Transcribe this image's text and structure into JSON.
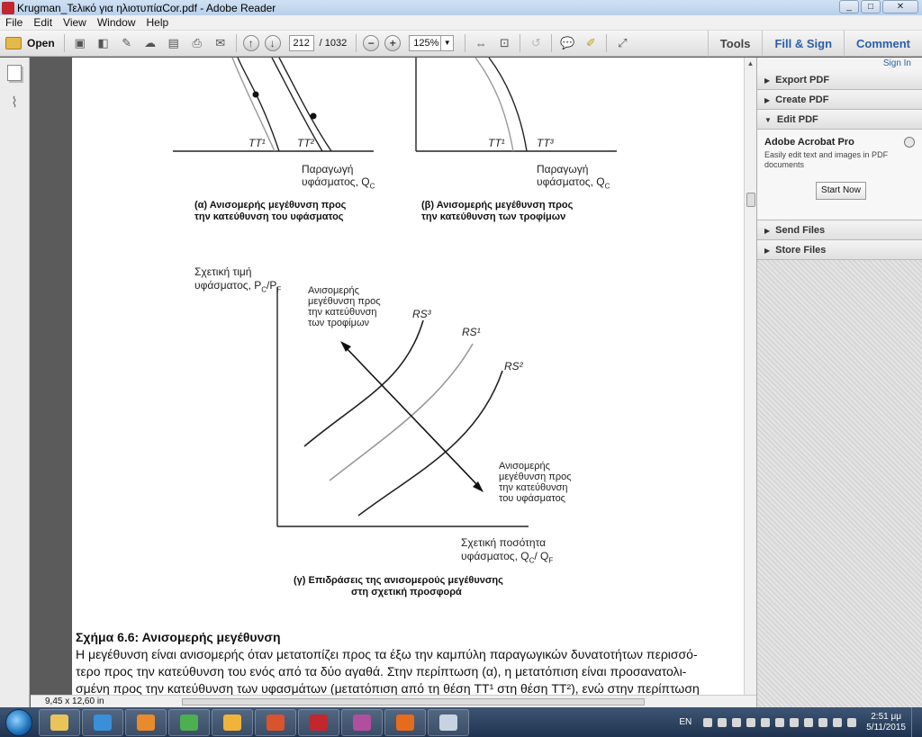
{
  "window": {
    "title": "Krugman_Τελικό για ηλιοτυπίαCor.pdf - Adobe Reader",
    "controls": [
      "_",
      "□",
      "✕"
    ]
  },
  "menu": [
    "File",
    "Edit",
    "View",
    "Window",
    "Help"
  ],
  "toolbar": {
    "open_label": "Open",
    "page_current": "212",
    "page_total": "/ 1032",
    "zoom": "125%",
    "tools_label": "Tools",
    "fill_sign_label": "Fill & Sign",
    "comment_label": "Comment"
  },
  "document": {
    "fig_top_left": {
      "curve1": "TT¹",
      "curve2": "TT²",
      "axis_label_line1": "Παραγωγή",
      "axis_label_line2": "υφάσματος, Q",
      "axis_sub": "C",
      "caption_line1": "(α) Ανισομερής μεγέθυνση προς",
      "caption_line2": "την κατεύθυνση του υφάσματος"
    },
    "fig_top_right": {
      "curve1": "TT¹",
      "curve2": "TT³",
      "axis_label_line1": "Παραγωγή",
      "axis_label_line2": "υφάσματος, Q",
      "axis_sub": "C",
      "caption_line1": "(β) Ανισομερής μεγέθυνση προς",
      "caption_line2": "την κατεύθυνση των τροφίμων"
    },
    "fig_bottom": {
      "y_label_line1": "Σχετική τιμή",
      "y_label_line2": "υφάσματος, P",
      "y_sub1": "C",
      "y_mid": "/P",
      "y_sub2": "F",
      "curve_rs3": "RS³",
      "curve_rs1": "RS¹",
      "curve_rs2": "RS²",
      "annot_food_1": "Ανισομερής",
      "annot_food_2": "μεγέθυνση προς",
      "annot_food_3": "την κατεύθυνση",
      "annot_food_4": "των τροφίμων",
      "annot_cloth_1": "Ανισομερής",
      "annot_cloth_2": "μεγέθυνση προς",
      "annot_cloth_3": "την κατεύθυνση",
      "annot_cloth_4": "του υφάσματος",
      "x_label_line1": "Σχετική ποσότητα",
      "x_label_line2": "υφάσματος, Q",
      "x_sub1": "C",
      "x_mid": "/ Q",
      "x_sub2": "F",
      "caption_line1": "(γ) Επιδράσεις της ανισομερούς μεγέθυνσης",
      "caption_line2": "στη σχετική προσφορά"
    },
    "section_title": "Σχήμα 6.6: Ανισομερής μεγέθυνση",
    "paragraph_lines": [
      "Η μεγέθυνση είναι ανισομερής όταν μετατοπίζει προς τα έξω την καμπύλη παραγωγικών δυνατοτήτων περισσό-",
      "τερο προς την κατεύθυνση του ενός από τα δύο αγαθά. Στην περίπτωση (α), η μετατόπιση είναι προσανατολι-",
      "σμένη προς την κατεύθυνση των υφασμάτων (μετατόπιση από τη θέση TT¹ στη θέση TT²), ενώ στην περίπτωση"
    ]
  },
  "statusbar": {
    "page_size": "9,45 x 12,60 in"
  },
  "rightpane": {
    "signin": "Sign In",
    "export_pdf": "Export PDF",
    "create_pdf": "Create PDF",
    "edit_pdf": "Edit PDF",
    "product": "Adobe Acrobat Pro",
    "product_desc": "Easily edit text and images in PDF documents",
    "start_now": "Start Now",
    "send_files": "Send Files",
    "store_files": "Store Files"
  },
  "taskbar": {
    "lang": "EN",
    "time": "2:51 μμ",
    "date": "5/11/2015",
    "apps": [
      {
        "name": "explorer",
        "color": "#e9c45a"
      },
      {
        "name": "internet-explorer",
        "color": "#3a8fd8"
      },
      {
        "name": "media-player",
        "color": "#e98a2c"
      },
      {
        "name": "chrome",
        "color": "#4caf50"
      },
      {
        "name": "outlook",
        "color": "#f0b43a"
      },
      {
        "name": "powerpoint",
        "color": "#d9532c"
      },
      {
        "name": "adobe-reader",
        "color": "#c1272d"
      },
      {
        "name": "paint",
        "color": "#b04fa0"
      },
      {
        "name": "firefox",
        "color": "#e66b1d"
      },
      {
        "name": "snipping",
        "color": "#c7d3e2"
      }
    ]
  }
}
